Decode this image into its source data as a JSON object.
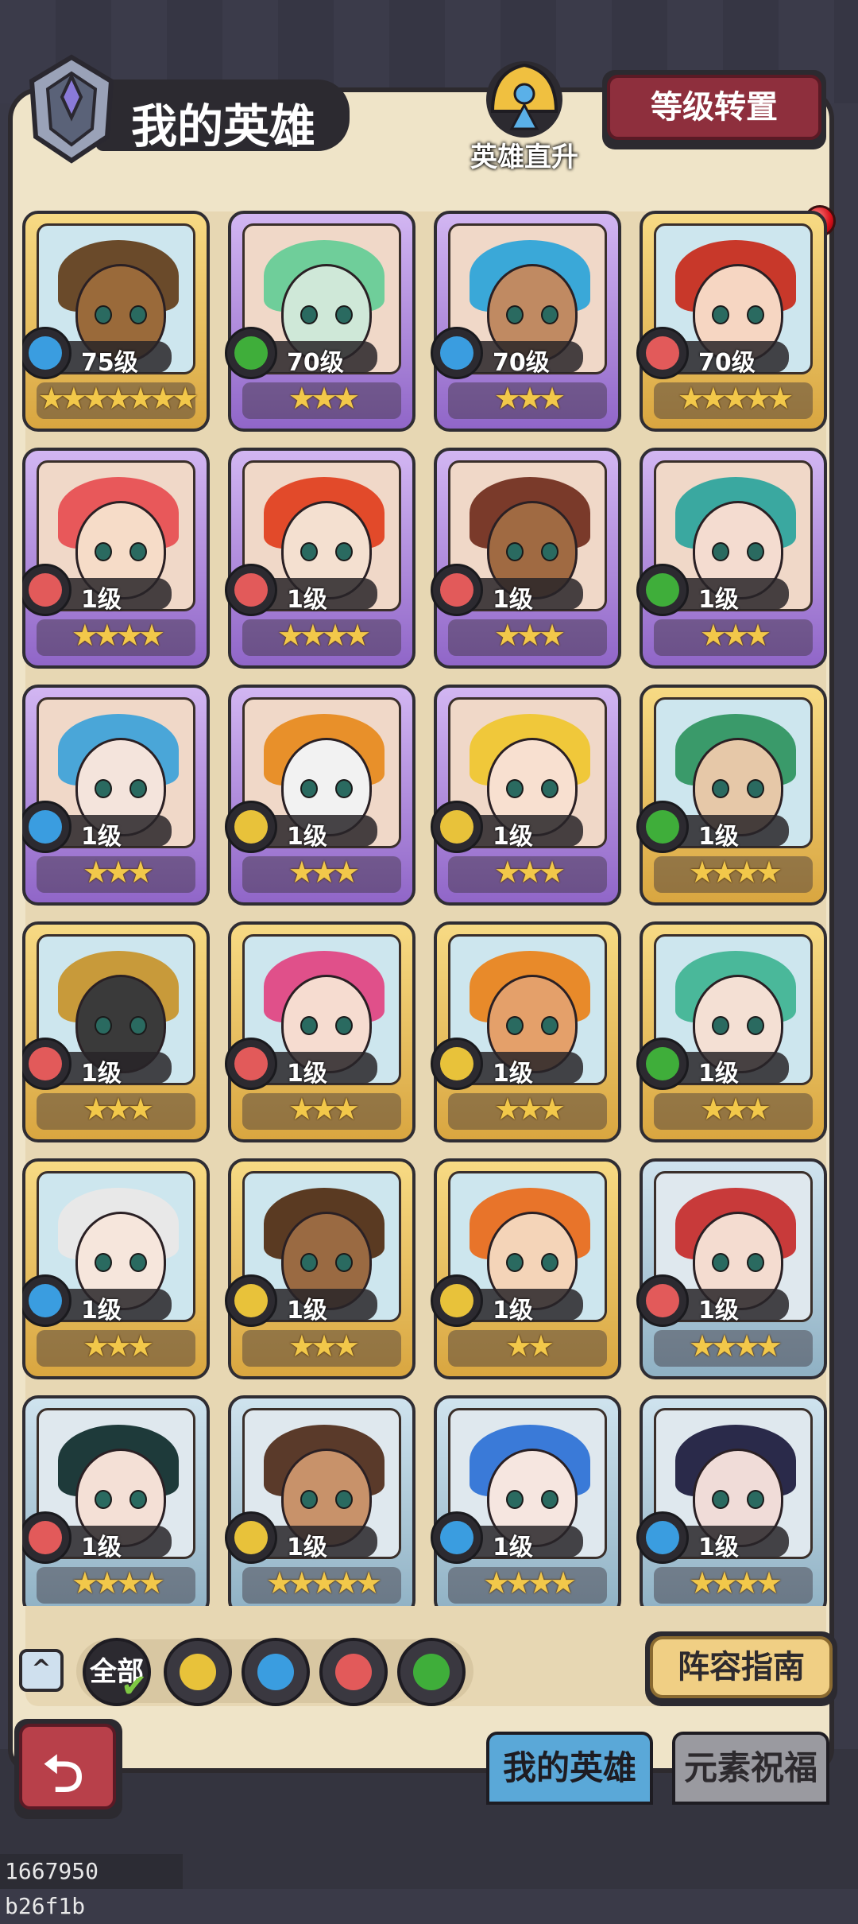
{
  "header": {
    "title": "我的英雄",
    "hero_boost_label": "英雄直升",
    "level_transfer_label": "等级转置"
  },
  "colors": {
    "fire": "#e25a5a",
    "water": "#3a9de0",
    "wind": "#3fae3a",
    "earth": "#e8c23a"
  },
  "heroes": [
    {
      "level": "75级",
      "stars": "★★★★★★★",
      "element": "water",
      "frame": "gold",
      "skin": "#9a6a3a",
      "hair": "#6a4a2a"
    },
    {
      "level": "70级",
      "stars": "★★★",
      "element": "wind",
      "frame": "purple",
      "skin": "#cfe8d8",
      "hair": "#6fce9a"
    },
    {
      "level": "70级",
      "stars": "★★★",
      "element": "water",
      "frame": "purple",
      "skin": "#c08a62",
      "hair": "#3aa8d8"
    },
    {
      "level": "70级",
      "stars": "★★★★★",
      "element": "fire",
      "frame": "gold",
      "skin": "#f6d6c2",
      "hair": "#c8382a"
    },
    {
      "level": "1级",
      "stars": "★★★★",
      "element": "fire",
      "frame": "purple",
      "skin": "#f6dcc8",
      "hair": "#e8585a"
    },
    {
      "level": "1级",
      "stars": "★★★★",
      "element": "fire",
      "frame": "purple",
      "skin": "#f4e0d0",
      "hair": "#e24a2a"
    },
    {
      "level": "1级",
      "stars": "★★★",
      "element": "fire",
      "frame": "purple",
      "skin": "#a06a42",
      "hair": "#7a3a2a"
    },
    {
      "level": "1级",
      "stars": "★★★",
      "element": "wind",
      "frame": "purple",
      "skin": "#f4dcd0",
      "hair": "#3aa8a0"
    },
    {
      "level": "1级",
      "stars": "★★★",
      "element": "water",
      "frame": "purple",
      "skin": "#f4e4dc",
      "hair": "#4aa6d8"
    },
    {
      "level": "1级",
      "stars": "★★★",
      "element": "earth",
      "frame": "purple",
      "skin": "#f2f2f2",
      "hair": "#e8902a"
    },
    {
      "level": "1级",
      "stars": "★★★",
      "element": "earth",
      "frame": "purple",
      "skin": "#f8e0d0",
      "hair": "#f0c83a"
    },
    {
      "level": "1级",
      "stars": "★★★★",
      "element": "wind",
      "frame": "gold",
      "skin": "#e6c8a8",
      "hair": "#3a9a6a"
    },
    {
      "level": "1级",
      "stars": "★★★",
      "element": "fire",
      "frame": "gold",
      "skin": "#3a3a3a",
      "hair": "#c89a3a"
    },
    {
      "level": "1级",
      "stars": "★★★",
      "element": "fire",
      "frame": "gold",
      "skin": "#f6dcd0",
      "hair": "#e0508a"
    },
    {
      "level": "1级",
      "stars": "★★★",
      "element": "earth",
      "frame": "gold",
      "skin": "#e4a06a",
      "hair": "#e88a2a"
    },
    {
      "level": "1级",
      "stars": "★★★",
      "element": "wind",
      "frame": "gold",
      "skin": "#f4e0d4",
      "hair": "#4ab89a"
    },
    {
      "level": "1级",
      "stars": "★★★",
      "element": "water",
      "frame": "gold",
      "skin": "#f6e6dc",
      "hair": "#e8e8e8"
    },
    {
      "level": "1级",
      "stars": "★★★",
      "element": "earth",
      "frame": "gold",
      "skin": "#9a6a42",
      "hair": "#5a3a22"
    },
    {
      "level": "1级",
      "stars": "★★",
      "element": "earth",
      "frame": "gold",
      "skin": "#f4d4b8",
      "hair": "#e8742a"
    },
    {
      "level": "1级",
      "stars": "★★★★",
      "element": "fire",
      "frame": "blue",
      "skin": "#f4dcd0",
      "hair": "#c83a3a"
    },
    {
      "level": "1级",
      "stars": "★★★★",
      "element": "fire",
      "frame": "blue",
      "skin": "#f4e0d6",
      "hair": "#1e3a3a"
    },
    {
      "level": "1级",
      "stars": "★★★★★",
      "element": "earth",
      "frame": "blue",
      "skin": "#c8926a",
      "hair": "#5a3a2a"
    },
    {
      "level": "1级",
      "stars": "★★★★",
      "element": "water",
      "frame": "blue",
      "skin": "#f6e6e0",
      "hair": "#3a7ad8"
    },
    {
      "level": "1级",
      "stars": "★★★★",
      "element": "water",
      "frame": "blue",
      "skin": "#f0dcd8",
      "hair": "#2a2a4a"
    }
  ],
  "filters": {
    "all_label": "全部",
    "elements": [
      "earth",
      "water",
      "fire",
      "wind"
    ]
  },
  "lineup_guide_label": "阵容指南",
  "tabs": {
    "my_heroes": "我的英雄",
    "element_blessing": "元素祝福"
  },
  "footer": {
    "build_id": "1667950 b26f1b"
  }
}
